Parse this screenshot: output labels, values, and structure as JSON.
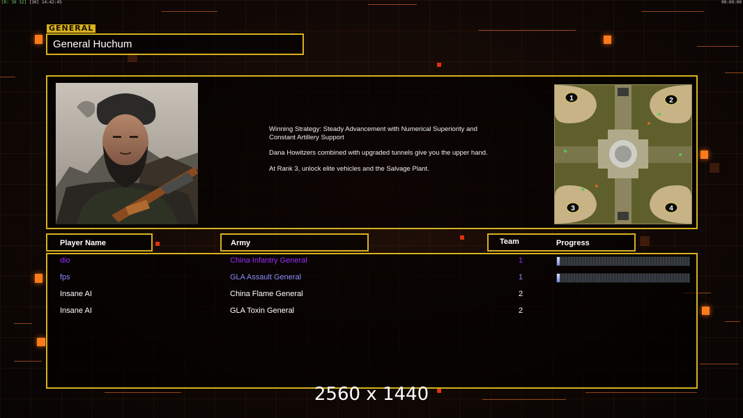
{
  "overlay": {
    "fps_counter": "[R: 30 32]",
    "frame_info": "[30]",
    "time_left": "14:42:45",
    "time_right": "00:00:00"
  },
  "general": {
    "section_tag": "GENERAL",
    "name": "General Huchum",
    "portrait_icon": "guerrilla-general-portrait",
    "strategy_lines": [
      "Winning Strategy: Steady Advancement with Numerical Superiority and Constant Artillery Support",
      "Dana Howitzers combined with upgraded tunnels give you the upper hand.",
      "At Rank 3, unlock elite vehicles and the Salvage Plant."
    ]
  },
  "minimap": {
    "icon": "desert-map-preview",
    "start_positions": [
      "1",
      "2",
      "3",
      "4"
    ]
  },
  "table": {
    "headers": {
      "player": "Player Name",
      "army": "Army",
      "team": "Team",
      "progress": "Progress"
    },
    "rows": [
      {
        "player": "dio",
        "army": "China Infantry General",
        "team": "1",
        "progress": 0.02,
        "color": "#9a2cff"
      },
      {
        "player": "fps",
        "army": "GLA Assault General",
        "team": "1",
        "progress": 0.02,
        "color": "#8a8cff"
      },
      {
        "player": "Insane AI",
        "army": "China Flame General",
        "team": "2",
        "color": "#ffffff"
      },
      {
        "player": "Insane AI",
        "army": "GLA Toxin General",
        "team": "2",
        "color": "#ffffff"
      }
    ]
  },
  "resolution_label": "2560 x 1440",
  "colors": {
    "accent_gold": "#d8b21f",
    "accent_orange": "#ff7a1a"
  }
}
